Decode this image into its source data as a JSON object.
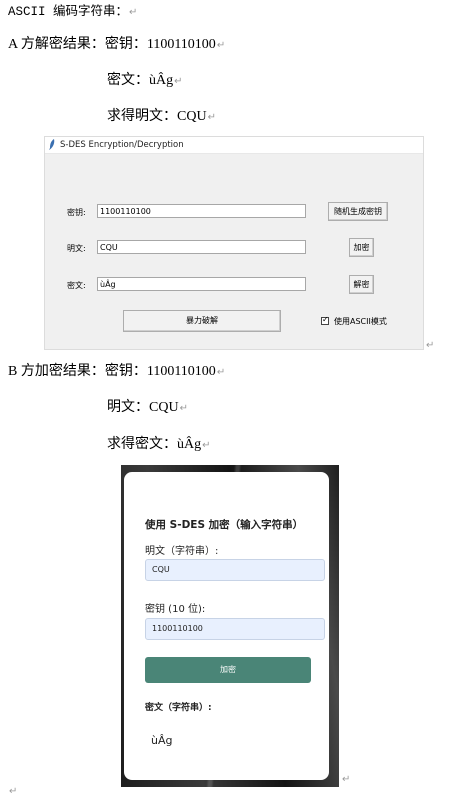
{
  "doc": {
    "line1": "ASCII 编码字符串：",
    "sectionA": {
      "label": "A 方解密结果：",
      "key_label": "密钥：",
      "key_value": "1100110100",
      "cipher_label": "密文：",
      "cipher_value": "ùÂg",
      "plain_label": "求得明文：",
      "plain_value": "CQU"
    },
    "sectionB": {
      "label": "B 方加密结果：",
      "key_label": "密钥：",
      "key_value": "1100110100",
      "plain_label": "明文：",
      "plain_value": "CQU",
      "cipher_label": "求得密文：",
      "cipher_value": "ùÂg"
    },
    "para_mark": "↵"
  },
  "tk_window": {
    "title": "S-DES Encryption/Decryption",
    "key_label": "密钥:",
    "key_value": "1100110100",
    "plain_label": "明文:",
    "plain_value": "CQU",
    "cipher_label": "密文:",
    "cipher_value": "ùÂg",
    "gen_key_button": "随机生成密钥",
    "encrypt_button": "加密",
    "decrypt_button": "解密",
    "brute_button": "暴力破解",
    "ascii_mode_label": "使用ASCII模式",
    "ascii_mode_checked": true
  },
  "web_form": {
    "heading": "使用 S-DES 加密（输入字符串）",
    "plain_label": "明文（字符串）:",
    "plain_value": "CQU",
    "key_label": "密钥 (10 位):",
    "key_value": "1100110100",
    "encrypt_button": "加密",
    "output_label": "密文（字符串）:",
    "output_value": "ùÂg"
  }
}
